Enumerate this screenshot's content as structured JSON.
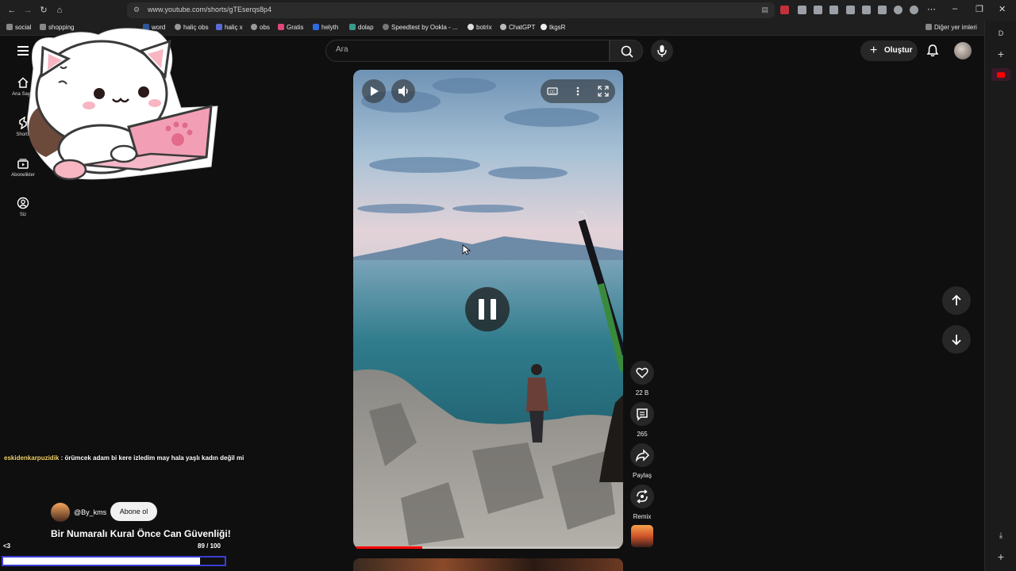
{
  "browser": {
    "url": "www.youtube.com/shorts/gTEserqs8p4",
    "bookmarks": [
      "social",
      "shopping",
      "word",
      "haliç obs",
      "haliç x",
      "obs",
      "Gratis",
      "helyth",
      "dolap",
      "Speedtest by Ookla - ...",
      "botrix",
      "ChatGPT",
      "tkgsR"
    ],
    "other_bookmarks": "Diğer yer imleri"
  },
  "header": {
    "search_placeholder": "Ara",
    "create_label": "Oluştur"
  },
  "left_nav": {
    "items": [
      {
        "label": "Ana Sayfa",
        "icon": "home-icon"
      },
      {
        "label": "Shorts",
        "icon": "shorts-icon"
      },
      {
        "label": "Abonelikler",
        "icon": "subscriptions-icon"
      },
      {
        "label": "Siz",
        "icon": "you-icon"
      }
    ]
  },
  "video": {
    "progress_fraction": 0.25
  },
  "actions": {
    "likes": "22 B",
    "comments": "265",
    "share": "Paylaş",
    "remix": "Remix"
  },
  "overlay": {
    "chat_user": "eskidenkarpuzidik",
    "chat_text": " : örümcek adam bi kere izledim may hala yaşlı kadın değil mi",
    "channel_name": "@By_kms",
    "subscribe_label": "Abone ol",
    "short_title": "Bir Numaralı Kural Önce Can Güvenliği!",
    "heart_text": "<3",
    "counter_text": "89 / 100",
    "counter_value": 89,
    "counter_max": 100
  },
  "colors": {
    "youtube_red": "#ff0000",
    "chat_user_yellow": "#f3d36b",
    "counter_border": "#3d3dd6"
  }
}
